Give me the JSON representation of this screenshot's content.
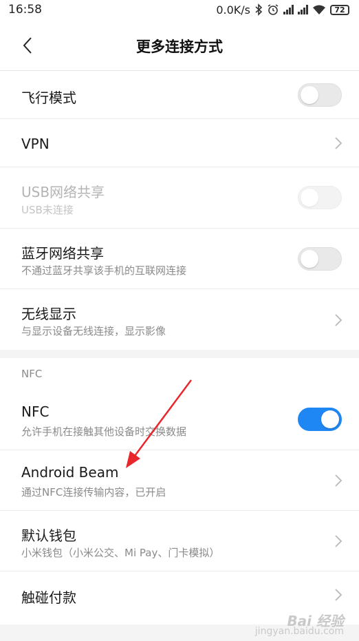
{
  "status": {
    "time": "16:58",
    "net_speed": "0.0K/s",
    "battery": "72",
    "icons": [
      "bluetooth-icon",
      "alarm-icon",
      "signal-icon",
      "signal-icon",
      "wifi-icon",
      "battery-icon"
    ]
  },
  "header": {
    "title": "更多连接方式",
    "back_icon": "back-chevron-icon"
  },
  "rows": {
    "airplane": {
      "title": "飞行模式",
      "toggle": "off"
    },
    "vpn": {
      "title": "VPN"
    },
    "usb_tether": {
      "title": "USB网络共享",
      "subtitle": "USB未连接",
      "toggle": "off",
      "disabled": true
    },
    "bt_tether": {
      "title": "蓝牙网络共享",
      "subtitle": "不通过蓝牙共享该手机的互联网连接",
      "toggle": "off"
    },
    "wireless_display": {
      "title": "无线显示",
      "subtitle": "与显示设备无线连接，显示影像"
    },
    "nfc": {
      "title": "NFC",
      "subtitle": "允许手机在接触其他设备时交换数据",
      "toggle": "on"
    },
    "android_beam": {
      "title": "Android Beam",
      "subtitle": "通过NFC连接传输内容，已开启"
    },
    "default_wallet": {
      "title": "默认钱包",
      "subtitle": "小米钱包（小米公交、Mi Pay、门卡模拟）"
    },
    "tap_pay": {
      "title": "触碰付款"
    }
  },
  "sections": {
    "nfc_label": "NFC"
  },
  "colors": {
    "accent": "#1f87f4",
    "annotation_arrow": "#e8262b"
  },
  "watermark": {
    "main": "Bai 经验",
    "sub": "jingyan.baidu.com"
  }
}
